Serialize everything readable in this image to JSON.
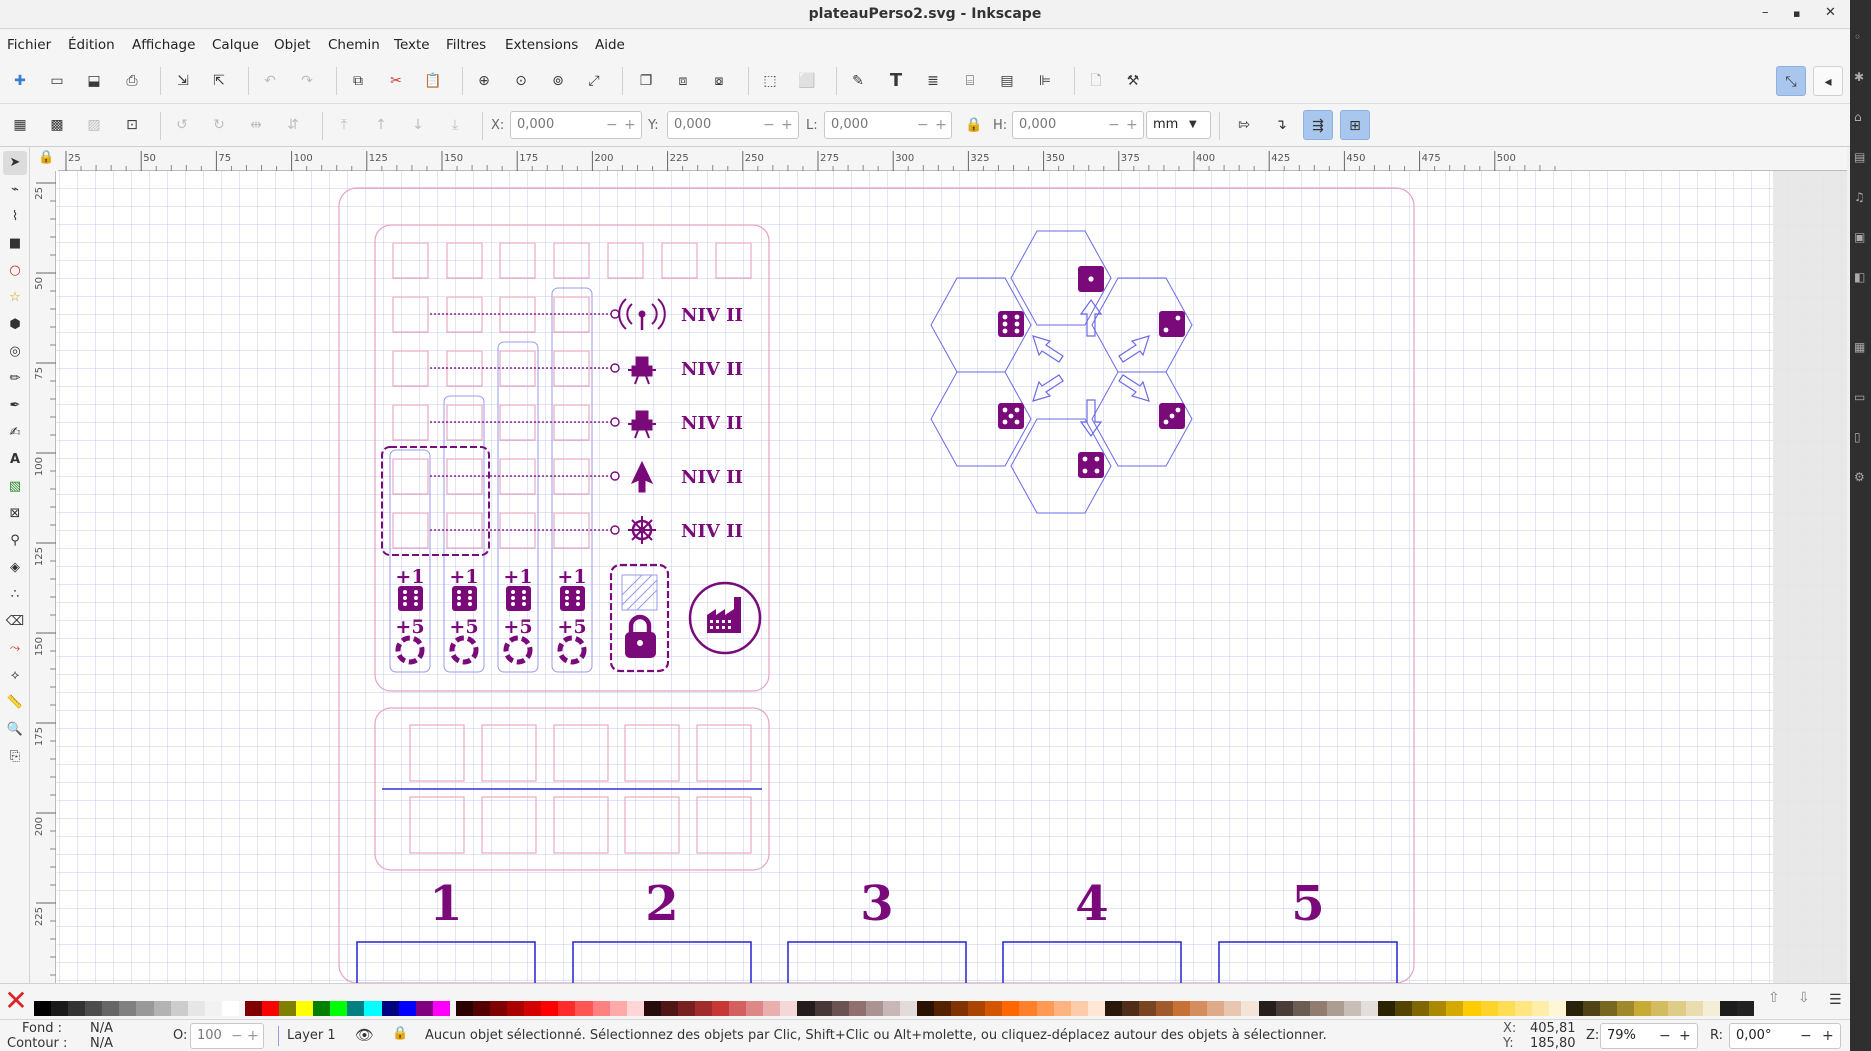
{
  "window": {
    "title": "plateauPerso2.svg - Inkscape",
    "controls": {
      "minimize": "–",
      "maximize": "▪",
      "close": "✕"
    }
  },
  "menu": [
    "Fichier",
    "Édition",
    "Affichage",
    "Calque",
    "Objet",
    "Chemin",
    "Texte",
    "Filtres",
    "Extensions",
    "Aide"
  ],
  "toolcontrols": {
    "x_label": "X:",
    "x_value": "0,000",
    "y_label": "Y:",
    "y_value": "0,000",
    "w_label": "L:",
    "w_value": "0,000",
    "h_label": "H:",
    "h_value": "0,000",
    "unit": "mm"
  },
  "rulers": {
    "horizontal": [
      "25",
      "50",
      "75",
      "100",
      "125",
      "150",
      "175",
      "200",
      "225",
      "250",
      "275",
      "300",
      "325",
      "350",
      "375",
      "400",
      "425",
      "450",
      "475",
      "500"
    ],
    "vertical": [
      "25",
      "50",
      "75",
      "100",
      "125",
      "150",
      "175",
      "200",
      "225"
    ]
  },
  "drawing": {
    "level_labels": [
      "NIV II",
      "NIV II",
      "NIV II",
      "NIV II",
      "NIV II"
    ],
    "bonus_top": "+1",
    "bonus_bottom": "+5",
    "player_numbers": [
      "1",
      "2",
      "3",
      "4",
      "5"
    ],
    "colors": {
      "purple": "#7a0a7a",
      "pink": "#e6a2c0",
      "blue": "#5050e0",
      "grid": "#c7c9f1",
      "page_shadow": "#e6e6e6"
    }
  },
  "statusbar": {
    "fill_label": "Fond :",
    "fill_value": "N/A",
    "stroke_label": "Contour :",
    "stroke_value": "N/A",
    "opacity_label": "O:",
    "opacity_value": "100",
    "layer": "Layer 1",
    "message": "Aucun objet sélectionné. Sélectionnez des objets par Clic, Shift+Clic ou Alt+molette, ou cliquez-déplacez autour des objets à sélectionner.",
    "cursor_x_label": "X:",
    "cursor_x": "405,81",
    "cursor_y_label": "Y:",
    "cursor_y": "185,80",
    "zoom_label": "Z:",
    "zoom": "79%",
    "rotation_label": "R:",
    "rotation": "0,00°"
  }
}
